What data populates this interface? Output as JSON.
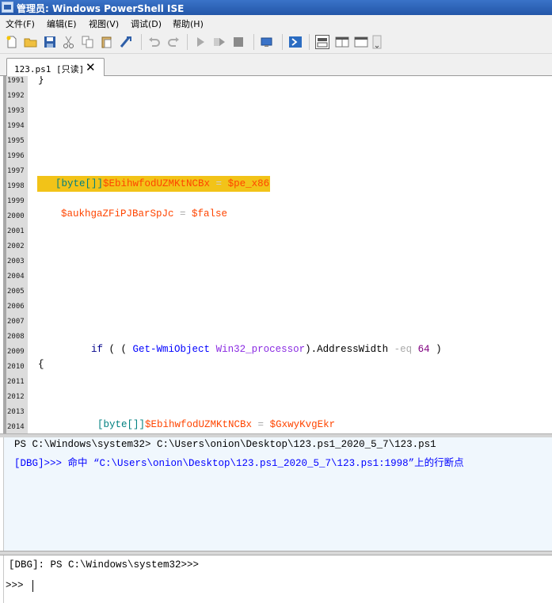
{
  "window": {
    "title": "管理员: Windows PowerShell ISE"
  },
  "menu": [
    "文件(F)",
    "编辑(E)",
    "视图(V)",
    "调试(D)",
    "帮助(H)"
  ],
  "toolbar": {
    "icons": [
      "new-icon",
      "open-icon",
      "save-icon",
      "cut-icon",
      "copy-icon",
      "paste-icon",
      "clear-icon",
      "undo-icon",
      "redo-icon",
      "run-icon",
      "run-selection-icon",
      "stop-icon",
      "remote-icon",
      "powershell-icon",
      "layout-top-icon",
      "layout-right-icon",
      "layout-max-icon"
    ]
  },
  "tab": {
    "label": "123.ps1 [只读]",
    "close": "✕"
  },
  "editor": {
    "line_numbers": [
      "1991",
      "1992",
      "1993",
      "1994",
      "1995",
      "1996",
      "1997",
      "1998",
      "1999",
      "2000",
      "2001",
      "2002",
      "2003",
      "2004",
      "2005",
      "2006",
      "2007",
      "2008",
      "2009",
      "2010",
      "2011",
      "2012",
      "2013",
      "2014"
    ],
    "line_1991": "}",
    "line_1998": {
      "type": "[byte[]]",
      "var": "$EbihwfodUZMKtNCBx",
      "op": " = ",
      "val": "$pe_x86"
    },
    "line_2000": {
      "var": "$aukhgaZFiPJBarSpJc",
      "op": " = ",
      "val": "$false"
    },
    "line_2009": {
      "kw": "if",
      "p1": " ( ( ",
      "cmd": "Get-WmiObject",
      "arg": " Win32_processor",
      "p2": ").AddressWidth ",
      "op": "-eq",
      "num": " 64",
      "p3": " )"
    },
    "line_2010": "{",
    "line_2014": {
      "type": "[byte[]]",
      "var": "$EbihwfodUZMKtNCBx",
      "op": " = ",
      "val": "$GxwyKvgEkr"
    },
    "highlight_color": "#f2c318"
  },
  "output": {
    "line1": "PS C:\\Windows\\system32> C:\\Users\\onion\\Desktop\\123.ps1_2020_5_7\\123.ps1",
    "line2": "[DBG]>>> 命中 “C:\\Users\\onion\\Desktop\\123.ps1_2020_5_7\\123.ps1:1998”上的行断点",
    "dbg_color": "#0000ff"
  },
  "console": {
    "prompt": "[DBG]: PS C:\\Windows\\system32>>>",
    "input_prompt": ">>> "
  }
}
